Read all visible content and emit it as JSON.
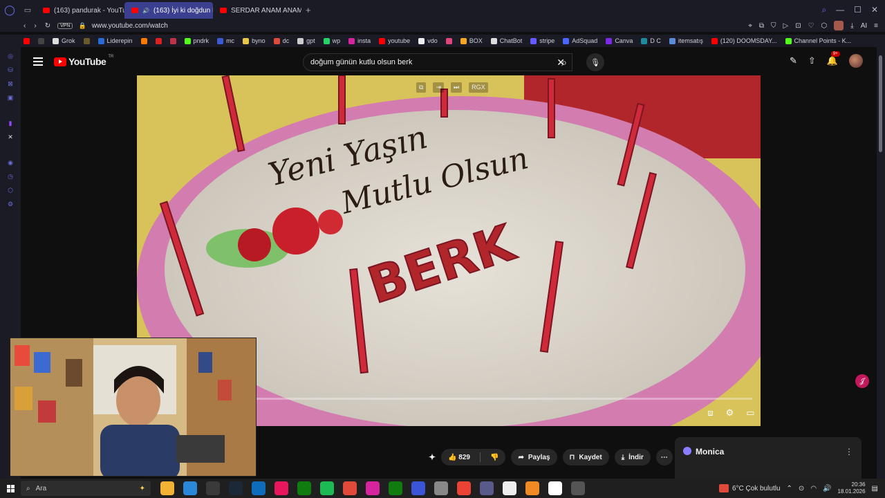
{
  "browser": {
    "tabs": [
      {
        "label": "(163) pandurak - YouTube",
        "active": false
      },
      {
        "label": "(163) İyi ki doğdun BE",
        "active": true
      },
      {
        "label": "SERDAR ANAM ANAM - S",
        "active": false
      }
    ],
    "new_tab": "+",
    "vpn_label": "VPN",
    "url": "www.youtube.com/watch",
    "ai_label": "AI",
    "bookmarks": [
      {
        "label": "",
        "color": "#ff0000"
      },
      {
        "label": "",
        "color": "#444444"
      },
      {
        "label": "Grok",
        "color": "#dddddd"
      },
      {
        "label": "",
        "color": "#6b5a2a"
      },
      {
        "label": "Liderepin",
        "color": "#2a6bd6"
      },
      {
        "label": "",
        "color": "#ff7a00"
      },
      {
        "label": "",
        "color": "#e02020"
      },
      {
        "label": "",
        "color": "#c0324a"
      },
      {
        "label": "pndrk",
        "color": "#53fc18"
      },
      {
        "label": "mc",
        "color": "#3a5bd0"
      },
      {
        "label": "byno",
        "color": "#e8c64a"
      },
      {
        "label": "dc",
        "color": "#e04a3b"
      },
      {
        "label": "gpt",
        "color": "#cccccc"
      },
      {
        "label": "wp",
        "color": "#25d366"
      },
      {
        "label": "insta",
        "color": "#d6249f"
      },
      {
        "label": "youtube",
        "color": "#ff0000"
      },
      {
        "label": "vdo",
        "color": "#eeeeee"
      },
      {
        "label": "",
        "color": "#e0457b"
      },
      {
        "label": "BOX",
        "color": "#f5a623"
      },
      {
        "label": "ChatBot",
        "color": "#dddddd"
      },
      {
        "label": "stripe",
        "color": "#635bff"
      },
      {
        "label": "AdSquad",
        "color": "#4a67ff"
      },
      {
        "label": "Canva",
        "color": "#7d2ae8"
      },
      {
        "label": "D C",
        "color": "#1f8a9e"
      },
      {
        "label": "itemsatış",
        "color": "#5a8ad8"
      },
      {
        "label": "(120) DOOMSDAY...",
        "color": "#ff0000"
      },
      {
        "label": "Channel Points - K...",
        "color": "#53fc18"
      }
    ]
  },
  "youtube": {
    "logo_text": "YouTube",
    "region": "TR",
    "search_value": "doğum günün kutlu olsun berk",
    "notification_count": "9+",
    "video": {
      "cake_text_line1": "Yeni Yaşın",
      "cake_text_line2": "Mutlu Olsun",
      "cake_name": "BERK",
      "overlay_tools": [
        "⧉",
        "⇥",
        "⏭",
        "RGX"
      ],
      "progress": 0.0
    },
    "actions": {
      "like_count": "829",
      "share_label": "Paylaş",
      "save_label": "Kaydet",
      "download_label": "İndir"
    },
    "side_panel_title": "Monica"
  },
  "taskbar": {
    "search_placeholder": "Ara",
    "apps": [
      "#f2b233",
      "#2b88d8",
      "#3a3a3a",
      "#1b2838",
      "#0f6cbd",
      "#e8175d",
      "#107c10",
      "#1db954",
      "#e04a3b",
      "#d6249f",
      "#107c10",
      "#3a55d8",
      "#888888",
      "#ea4335",
      "#5a5a8a",
      "#eeeeee",
      "#f08a24",
      "#ffffff",
      "#555555"
    ],
    "weather": "6°C  Çok bulutlu",
    "time": "20:36",
    "date": "18.01.2026"
  }
}
